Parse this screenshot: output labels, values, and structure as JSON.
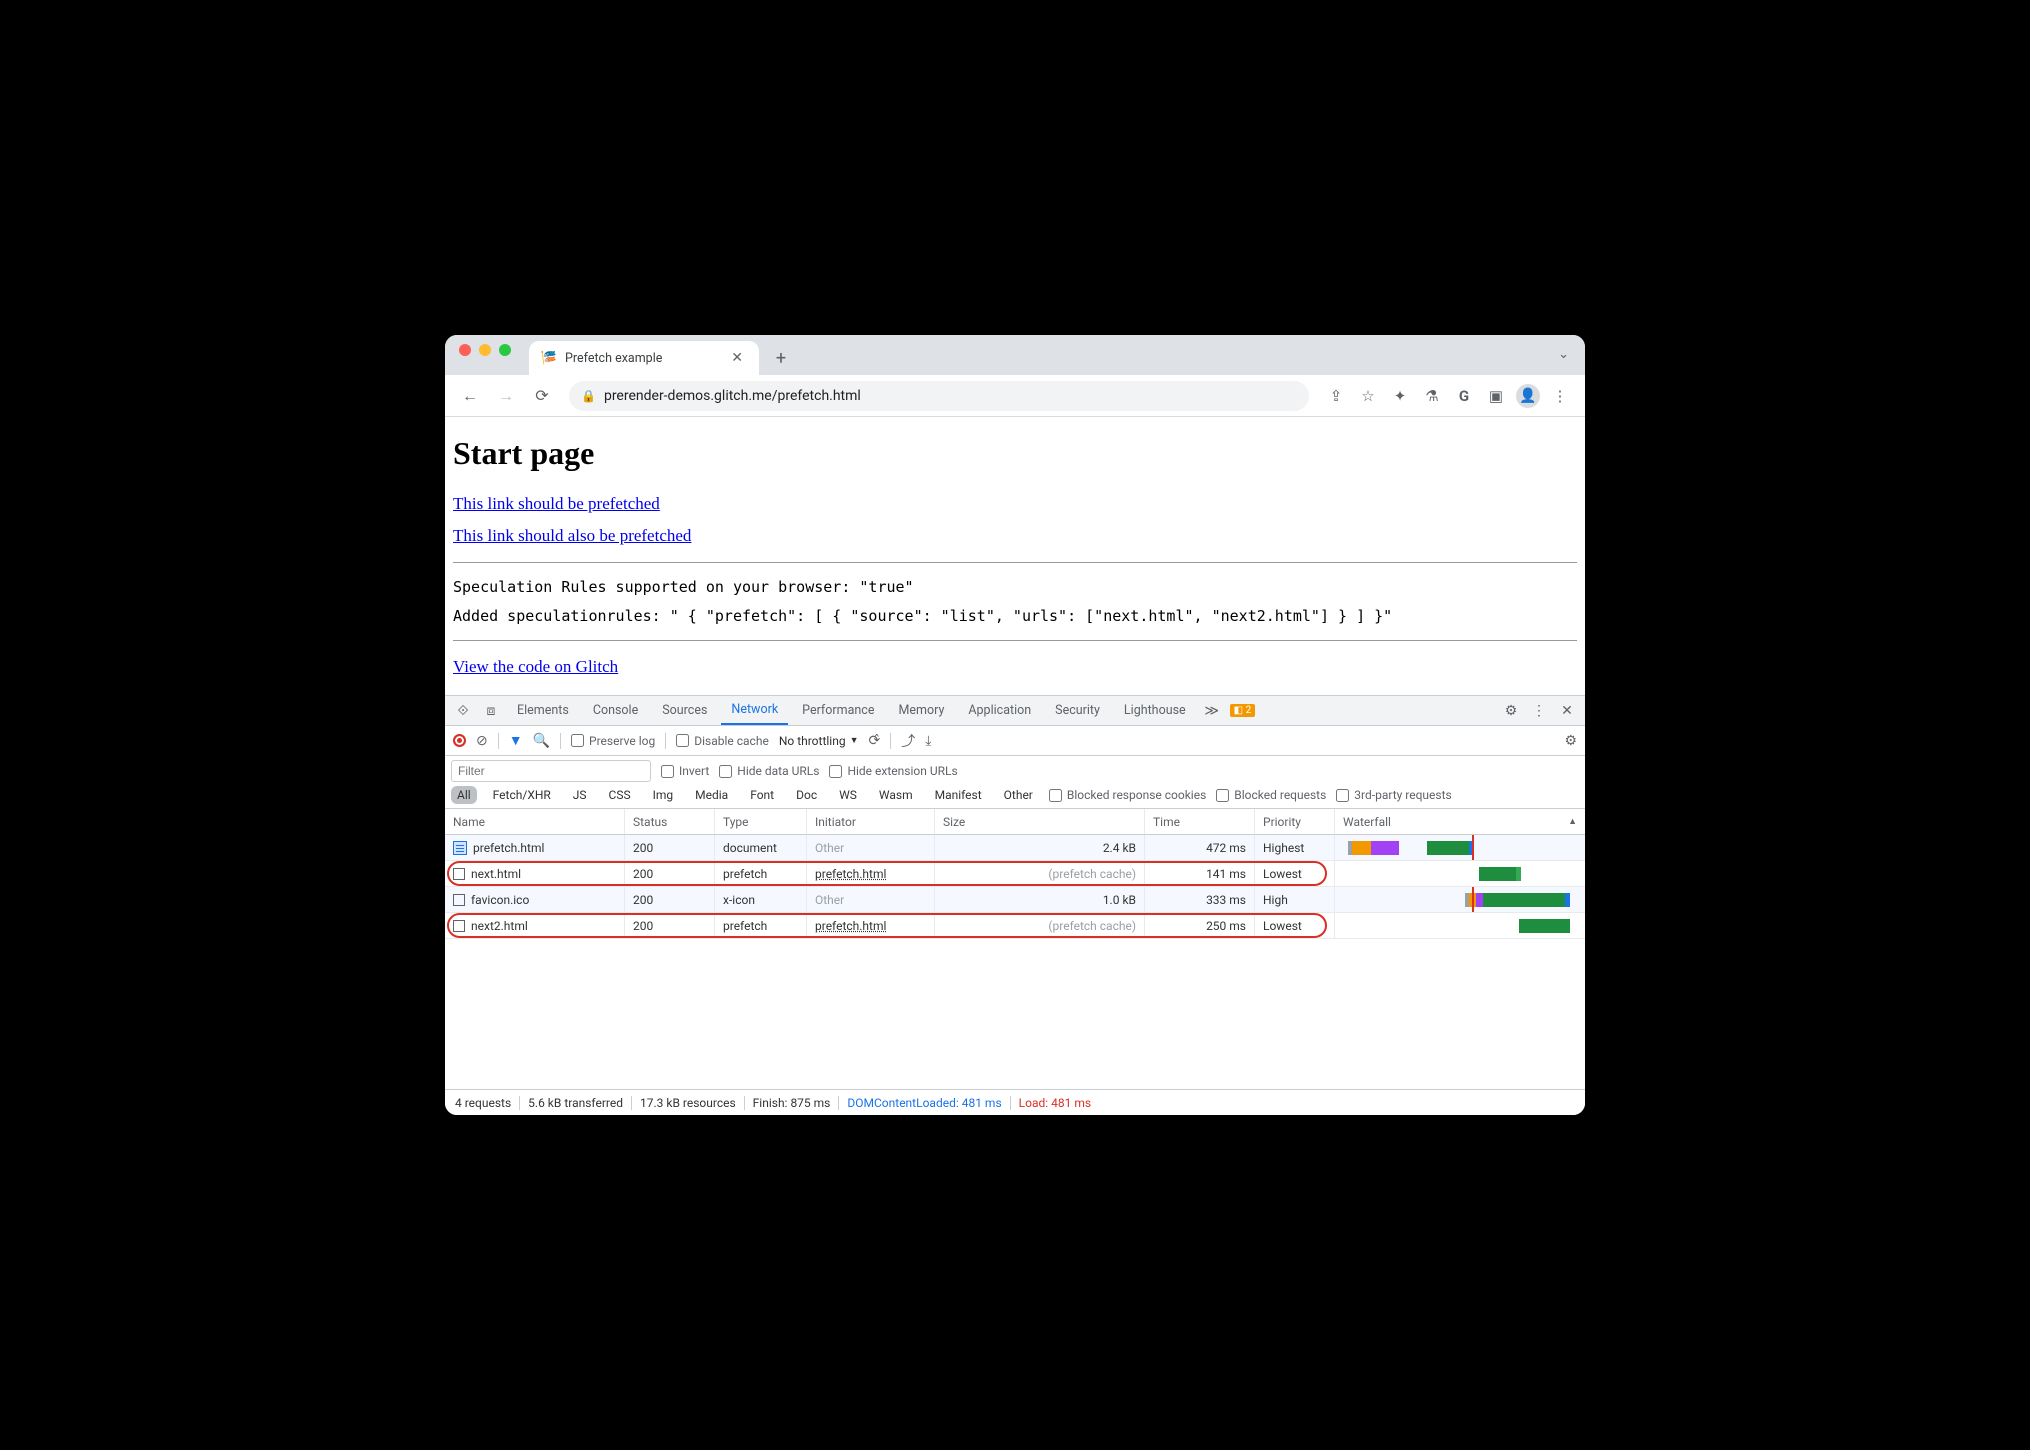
{
  "window": {
    "tab_title": "Prefetch example",
    "url": "prerender-demos.glitch.me/prefetch.html"
  },
  "page": {
    "heading": "Start page",
    "link1": "This link should be prefetched",
    "link2": "This link should also be prefetched",
    "mono_line1": "Speculation Rules supported on your browser: \"true\"",
    "mono_line2": "Added speculationrules: \" { \"prefetch\": [ { \"source\": \"list\", \"urls\": [\"next.html\", \"next2.html\"] } ] }\"",
    "link3": "View the code on Glitch"
  },
  "devtools": {
    "tabs": [
      "Elements",
      "Console",
      "Sources",
      "Network",
      "Performance",
      "Memory",
      "Application",
      "Security",
      "Lighthouse"
    ],
    "active_tab": "Network",
    "warn_count": "2",
    "net_toolbar": {
      "preserve_log": "Preserve log",
      "disable_cache": "Disable cache",
      "throttling": "No throttling"
    },
    "filter": {
      "placeholder": "Filter",
      "invert": "Invert",
      "hide_data": "Hide data URLs",
      "hide_ext": "Hide extension URLs",
      "types": [
        "All",
        "Fetch/XHR",
        "JS",
        "CSS",
        "Img",
        "Media",
        "Font",
        "Doc",
        "WS",
        "Wasm",
        "Manifest",
        "Other"
      ],
      "blocked_cookies": "Blocked response cookies",
      "blocked_requests": "Blocked requests",
      "third_party": "3rd-party requests"
    },
    "columns": {
      "name": "Name",
      "status": "Status",
      "type": "Type",
      "initiator": "Initiator",
      "size": "Size",
      "time": "Time",
      "priority": "Priority",
      "waterfall": "Waterfall"
    },
    "rows": [
      {
        "name": "prefetch.html",
        "status": "200",
        "type": "document",
        "initiator": "Other",
        "initiator_muted": true,
        "size": "2.4 kB",
        "size_muted": false,
        "time": "472 ms",
        "priority": "Highest",
        "icon": "doc"
      },
      {
        "name": "next.html",
        "status": "200",
        "type": "prefetch",
        "initiator": "prefetch.html",
        "initiator_muted": false,
        "size": "(prefetch cache)",
        "size_muted": true,
        "time": "141 ms",
        "priority": "Lowest",
        "icon": "box"
      },
      {
        "name": "favicon.ico",
        "status": "200",
        "type": "x-icon",
        "initiator": "Other",
        "initiator_muted": true,
        "size": "1.0 kB",
        "size_muted": false,
        "time": "333 ms",
        "priority": "High",
        "icon": "box"
      },
      {
        "name": "next2.html",
        "status": "200",
        "type": "prefetch",
        "initiator": "prefetch.html",
        "initiator_muted": false,
        "size": "(prefetch cache)",
        "size_muted": true,
        "time": "250 ms",
        "priority": "Lowest",
        "icon": "box"
      }
    ],
    "status": {
      "requests": "4 requests",
      "transferred": "5.6 kB transferred",
      "resources": "17.3 kB resources",
      "finish": "Finish: 875 ms",
      "dcl": "DOMContentLoaded: 481 ms",
      "load": "Load: 481 ms"
    }
  }
}
